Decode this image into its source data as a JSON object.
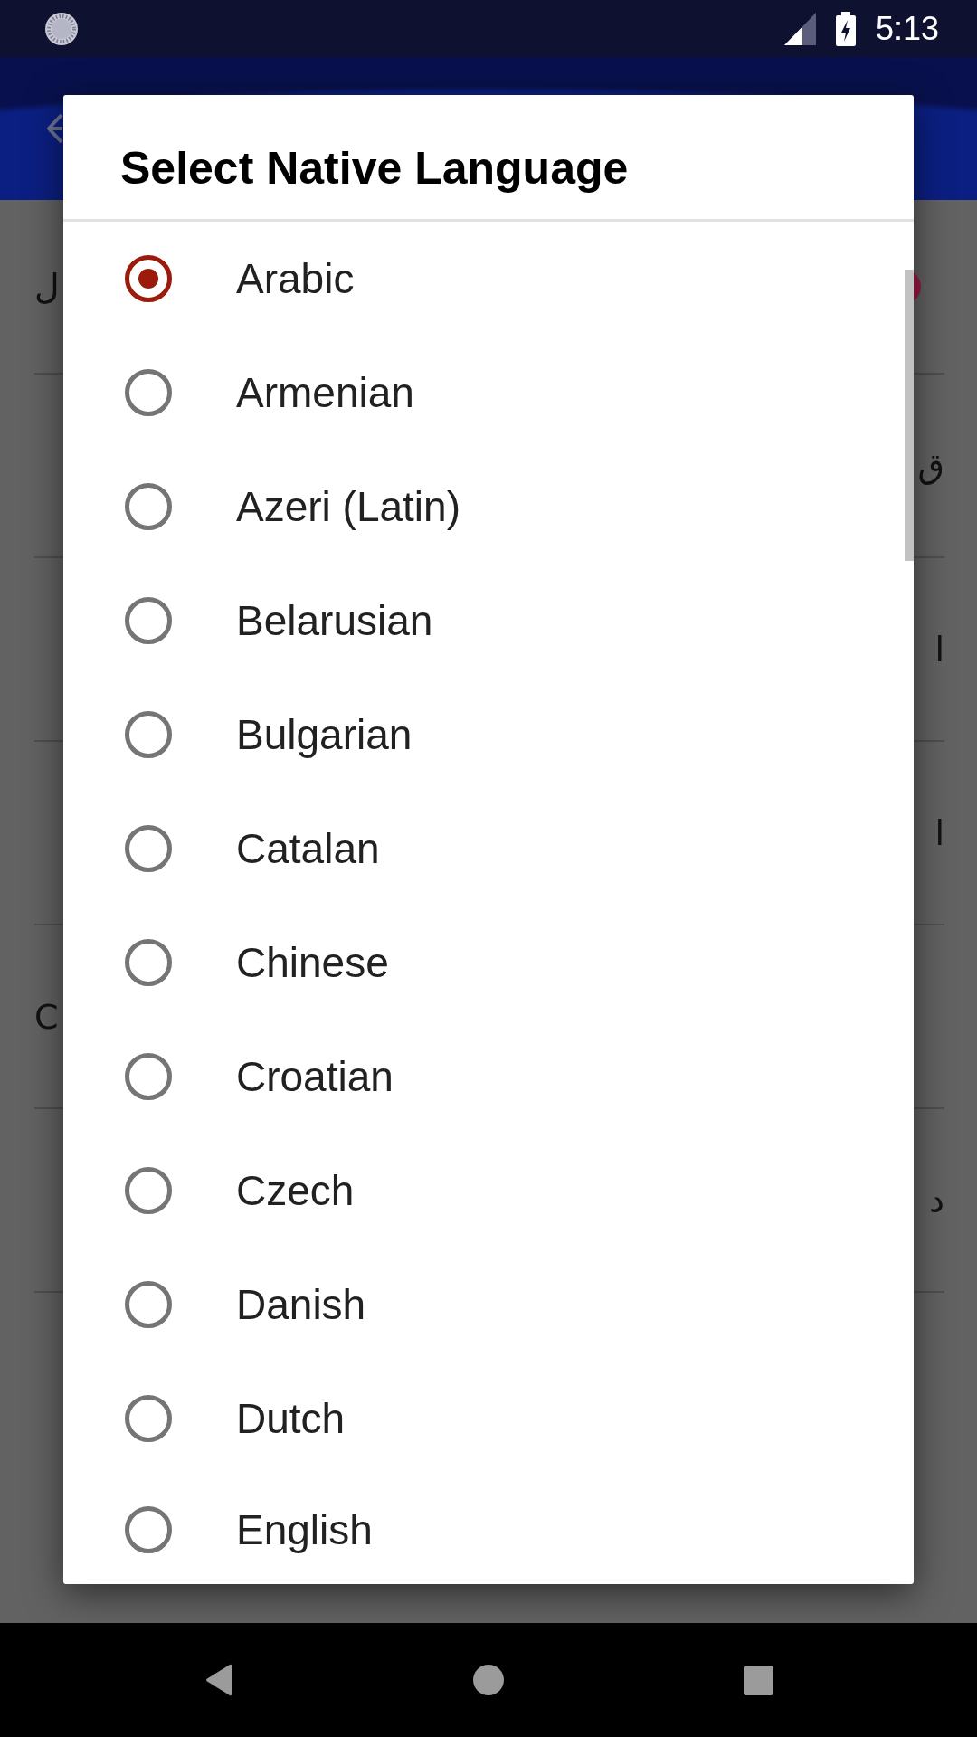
{
  "status_bar": {
    "time": "5:13"
  },
  "background": {
    "rows": [
      {
        "left_text": "ل",
        "dot": true
      },
      {
        "right_text": "ق",
        "dot": false
      },
      {
        "right_text": "ا",
        "dot": false
      },
      {
        "right_text": "ا",
        "dot": false
      },
      {
        "left_text": "C",
        "dot": false
      },
      {
        "right_text": "د",
        "dot": false
      }
    ]
  },
  "dialog": {
    "title": "Select Native Language",
    "options": [
      {
        "label": "Arabic",
        "selected": true
      },
      {
        "label": "Armenian",
        "selected": false
      },
      {
        "label": "Azeri (Latin)",
        "selected": false
      },
      {
        "label": "Belarusian",
        "selected": false
      },
      {
        "label": "Bulgarian",
        "selected": false
      },
      {
        "label": "Catalan",
        "selected": false
      },
      {
        "label": "Chinese",
        "selected": false
      },
      {
        "label": "Croatian",
        "selected": false
      },
      {
        "label": "Czech",
        "selected": false
      },
      {
        "label": "Danish",
        "selected": false
      },
      {
        "label": "Dutch",
        "selected": false
      },
      {
        "label": "English",
        "selected": false
      }
    ]
  }
}
